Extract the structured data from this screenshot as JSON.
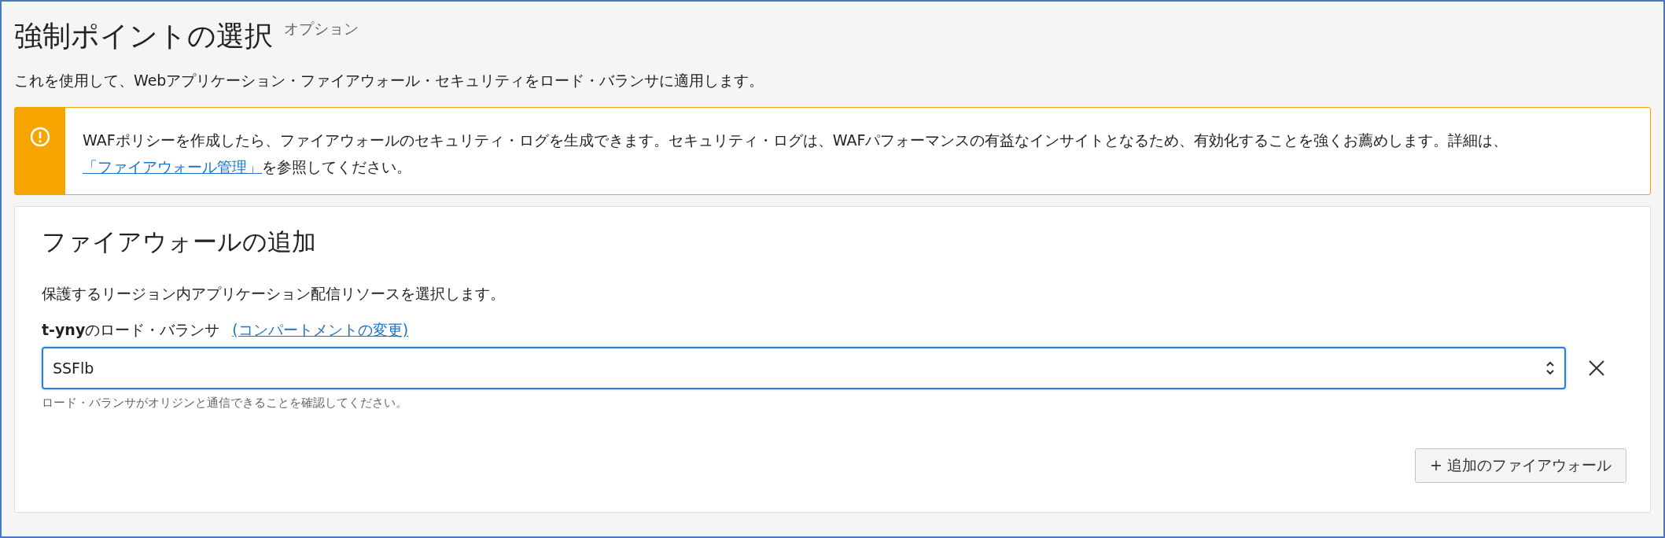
{
  "header": {
    "title": "強制ポイントの選択",
    "optional": "オプション",
    "description": "これを使用して、Webアプリケーション・ファイアウォール・セキュリティをロード・バランサに適用します。"
  },
  "alert": {
    "kind": "warning",
    "text_before": "WAFポリシーを作成したら、ファイアウォールのセキュリティ・ログを生成できます。セキュリティ・ログは、WAFパフォーマンスの有益なインサイトとなるため、有効化することを強くお薦めします。詳細は、",
    "link": "「ファイアウォール管理」",
    "text_after": "を参照してください。"
  },
  "card": {
    "title": "ファイアウォールの追加",
    "subtitle": "保護するリージョン内アプリケーション配信リソースを選択します。",
    "field": {
      "label": "**t-yny**のロード・バランサ",
      "link": "(コンパートメントの変更)",
      "value": "SSFlb",
      "focused": true,
      "help": "ロード・バランサがオリジンと通信できることを確認してください。"
    },
    "add_button": "+ 追加のファイアウォール"
  }
}
